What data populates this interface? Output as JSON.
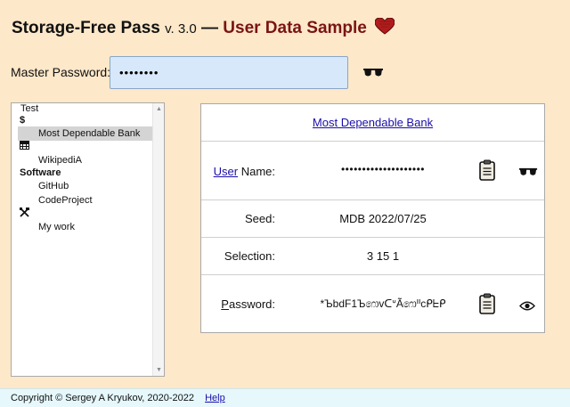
{
  "header": {
    "app_name": "Storage-Free Pass",
    "version": "v. 3.0",
    "dash": "—",
    "subtitle": "User Data Sample"
  },
  "master_password": {
    "label": "Master Password:",
    "value": "••••••••"
  },
  "tree": {
    "items": [
      {
        "kind": "group",
        "label": "Test"
      },
      {
        "kind": "symbol",
        "label": "$"
      },
      {
        "kind": "item",
        "label": "Most Dependable Bank",
        "selected": true
      },
      {
        "kind": "item",
        "label": "WikipediA"
      },
      {
        "kind": "group",
        "label": "Software"
      },
      {
        "kind": "item",
        "label": "GitHub"
      },
      {
        "kind": "item",
        "label": "CodeProject"
      },
      {
        "kind": "item",
        "label": "My work"
      }
    ]
  },
  "panel": {
    "title_link": "Most Dependable Bank",
    "user_name": {
      "label_link": "User",
      "label_rest": " Name:",
      "value": "••••••••••••••••••••"
    },
    "seed": {
      "label": "Seed:",
      "value": "MDB 2022/07/25"
    },
    "selection": {
      "label": "Selection:",
      "value": "3 15 1"
    },
    "password": {
      "label_underlined": "P",
      "label_rest": "assword:",
      "value": "*ЪbdF1Ъ෩vᑕᐡÃ෩ᐦcᑭᖶᑭ"
    }
  },
  "footer": {
    "copyright": "Copyright © Sergey A Kryukov, 2020-2022",
    "help": "Help"
  },
  "colors": {
    "background": "#fde8c9",
    "subtitle": "#7a1414",
    "heart": "#b01c1c",
    "input_bg": "#d7e8fb",
    "footer_bg": "#e6f8fc",
    "link": "#1a0dab"
  },
  "icons": [
    "heart-icon",
    "sunglasses-icon",
    "clipboard-icon",
    "eye-icon",
    "bank-icon",
    "tools-icon"
  ]
}
